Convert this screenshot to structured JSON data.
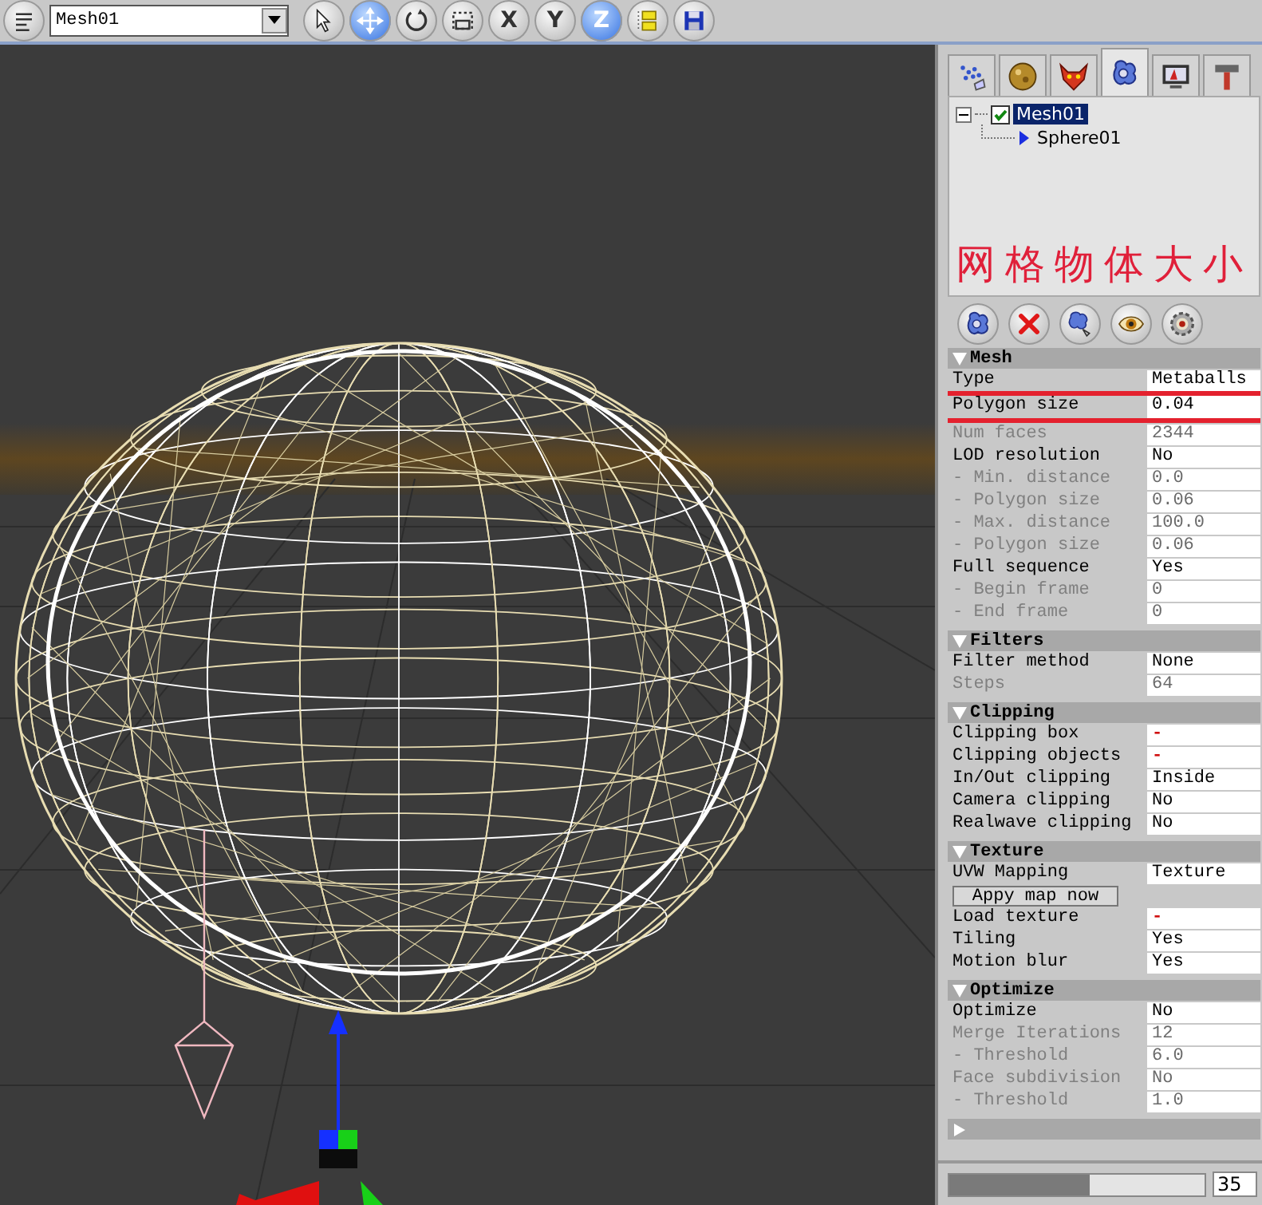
{
  "toolbar": {
    "object_field": {
      "value": "Mesh01"
    },
    "buttons": [
      {
        "kind": "icon",
        "selected": false
      },
      {
        "kind": "icon",
        "selected": true
      },
      {
        "kind": "icon",
        "selected": false
      },
      {
        "kind": "icon",
        "selected": false
      },
      {
        "kind": "letter",
        "label": "X",
        "selected": false
      },
      {
        "kind": "letter",
        "label": "Y",
        "selected": false
      },
      {
        "kind": "letter",
        "label": "Z",
        "selected": true
      },
      {
        "kind": "icon",
        "selected": false
      },
      {
        "kind": "icon",
        "selected": false
      }
    ]
  },
  "panel": {
    "tabs": [
      {
        "selected": false
      },
      {
        "selected": false
      },
      {
        "selected": false
      },
      {
        "selected": true
      },
      {
        "selected": false
      },
      {
        "selected": false
      }
    ],
    "tree": [
      {
        "label": "Mesh01",
        "checked": true,
        "selected": true,
        "expanded": true,
        "children": [
          {
            "label": "Sphere01"
          }
        ]
      }
    ],
    "annotation": "网格物体大小",
    "sections": [
      {
        "title": "Mesh",
        "expanded": true,
        "rows": [
          {
            "kind": "field",
            "label": "Type",
            "value": "Metaballs",
            "disabled": false,
            "annotated": false
          },
          {
            "kind": "field",
            "label": "Polygon size",
            "value": "0.04",
            "disabled": false,
            "annotated": true
          },
          {
            "kind": "field",
            "label": "Num faces",
            "value": "2344",
            "disabled": true,
            "annotated": false
          },
          {
            "kind": "field",
            "label": "LOD resolution",
            "value": "No",
            "disabled": false,
            "annotated": false
          },
          {
            "kind": "field",
            "label": "- Min. distance",
            "value": "0.0",
            "disabled": true,
            "annotated": false
          },
          {
            "kind": "field",
            "label": "- Polygon size",
            "value": "0.06",
            "disabled": true,
            "annotated": false
          },
          {
            "kind": "field",
            "label": "- Max. distance",
            "value": "100.0",
            "disabled": true,
            "annotated": false
          },
          {
            "kind": "field",
            "label": "- Polygon size",
            "value": "0.06",
            "disabled": true,
            "annotated": false
          },
          {
            "kind": "field",
            "label": "Full sequence",
            "value": "Yes",
            "disabled": false,
            "annotated": false
          },
          {
            "kind": "field",
            "label": "- Begin frame",
            "value": "0",
            "disabled": true,
            "annotated": false
          },
          {
            "kind": "field",
            "label": "- End frame",
            "value": "0",
            "disabled": true,
            "annotated": false
          }
        ]
      },
      {
        "title": "Filters",
        "expanded": true,
        "rows": [
          {
            "kind": "field",
            "label": "Filter method",
            "value": "None",
            "disabled": false,
            "annotated": false
          },
          {
            "kind": "field",
            "label": "Steps",
            "value": "64",
            "disabled": true,
            "annotated": false
          }
        ]
      },
      {
        "title": "Clipping",
        "expanded": true,
        "rows": [
          {
            "kind": "picker",
            "label": "Clipping box",
            "value": "-",
            "disabled": false,
            "annotated": false
          },
          {
            "kind": "picker",
            "label": "Clipping objects",
            "value": "-",
            "disabled": false,
            "annotated": false
          },
          {
            "kind": "field",
            "label": "In/Out clipping",
            "value": "Inside",
            "disabled": false,
            "annotated": false
          },
          {
            "kind": "field",
            "label": "Camera clipping",
            "value": "No",
            "disabled": false,
            "annotated": false
          },
          {
            "kind": "field",
            "label": "Realwave clipping",
            "value": "No",
            "disabled": false,
            "annotated": false
          }
        ]
      },
      {
        "title": "Texture",
        "expanded": true,
        "rows": [
          {
            "kind": "field",
            "label": "UVW Mapping",
            "value": "Texture",
            "disabled": false,
            "annotated": false
          },
          {
            "kind": "button",
            "label": "Appy map now",
            "disabled": false,
            "annotated": false
          },
          {
            "kind": "picker",
            "label": "Load texture",
            "value": "-",
            "disabled": false,
            "annotated": false
          },
          {
            "kind": "field",
            "label": "Tiling",
            "value": "Yes",
            "disabled": false,
            "annotated": false
          },
          {
            "kind": "field",
            "label": "Motion blur",
            "value": "Yes",
            "disabled": false,
            "annotated": false
          }
        ]
      },
      {
        "title": "Optimize",
        "expanded": true,
        "rows": [
          {
            "kind": "field",
            "label": "Optimize",
            "value": "No",
            "disabled": false,
            "annotated": false
          },
          {
            "kind": "field",
            "label": "Merge Iterations",
            "value": "12",
            "disabled": true,
            "annotated": false
          },
          {
            "kind": "field",
            "label": "- Threshold",
            "value": "6.0",
            "disabled": true,
            "annotated": false
          },
          {
            "kind": "field",
            "label": "Face subdivision",
            "value": "No",
            "disabled": true,
            "annotated": false
          },
          {
            "kind": "field",
            "label": "- Threshold",
            "value": "1.0",
            "disabled": true,
            "annotated": false
          }
        ]
      },
      {
        "expanded": false
      }
    ],
    "slider": {
      "level": 0.55,
      "value": "35"
    }
  }
}
